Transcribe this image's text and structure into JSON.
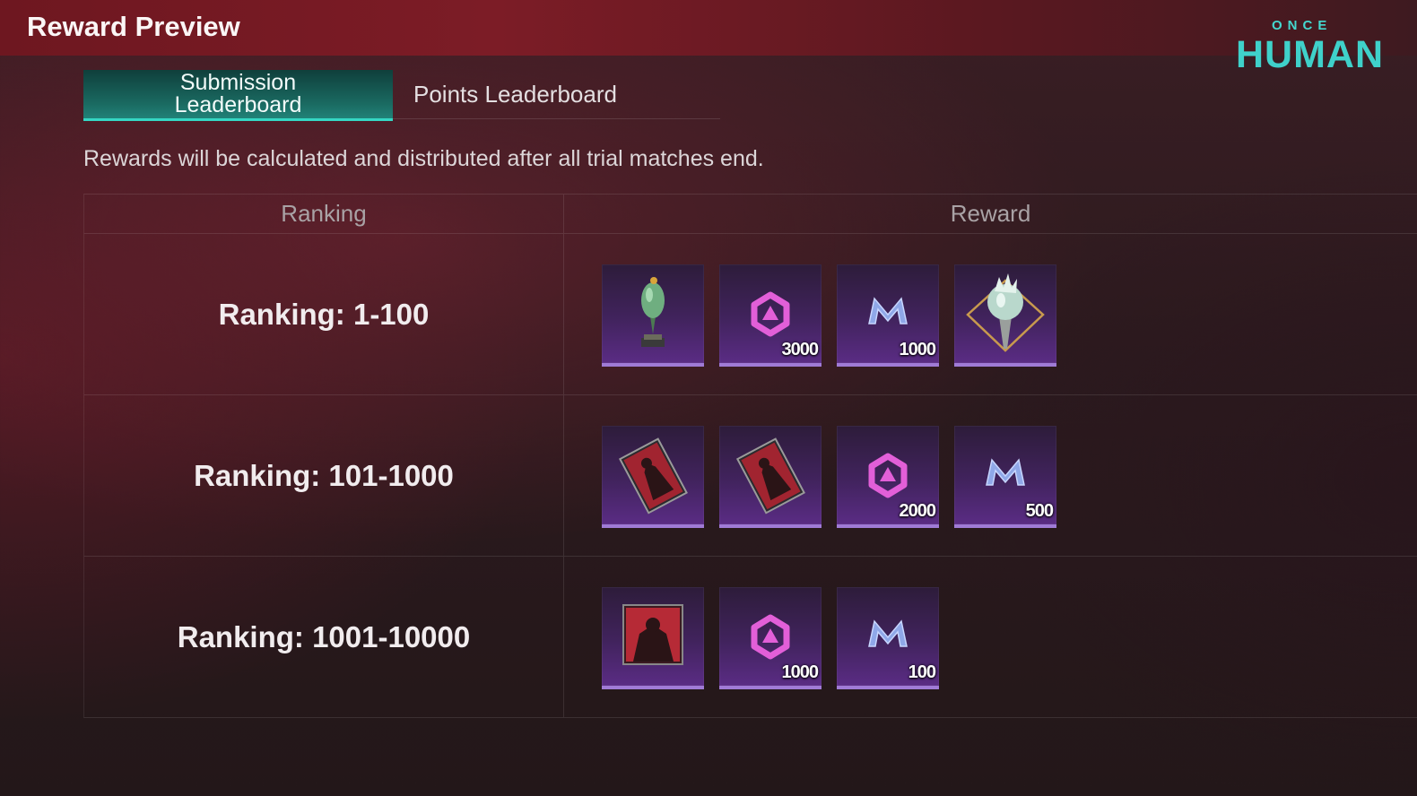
{
  "window": {
    "title": "Reward Preview"
  },
  "brand": {
    "top": "ONCE",
    "bottom": "HUMAN",
    "accent_color": "#3fd1ca"
  },
  "tabs": [
    {
      "label": "Submission Leaderboard",
      "active": true
    },
    {
      "label": "Points Leaderboard",
      "active": false
    }
  ],
  "notice": "Rewards will be calculated and distributed after all trial matches end.",
  "table": {
    "headers": {
      "ranking": "Ranking",
      "reward": "Reward"
    },
    "rows": [
      {
        "ranking": "Ranking: 1-100",
        "rewards": [
          {
            "icon": "green-trophy-decoration-icon",
            "qty": ""
          },
          {
            "icon": "hexagon-currency-icon",
            "qty": "3000"
          },
          {
            "icon": "m-currency-icon",
            "qty": "1000"
          },
          {
            "icon": "torch-badge-icon",
            "qty": ""
          }
        ]
      },
      {
        "ranking": "Ranking: 101-1000",
        "rewards": [
          {
            "icon": "red-card-icon",
            "qty": ""
          },
          {
            "icon": "red-card-icon",
            "qty": ""
          },
          {
            "icon": "hexagon-currency-icon",
            "qty": "2000"
          },
          {
            "icon": "m-currency-icon",
            "qty": "500"
          }
        ]
      },
      {
        "ranking": "Ranking: 1001-10000",
        "rewards": [
          {
            "icon": "portrait-frame-icon",
            "qty": ""
          },
          {
            "icon": "hexagon-currency-icon",
            "qty": "1000"
          },
          {
            "icon": "m-currency-icon",
            "qty": "100"
          }
        ]
      }
    ]
  },
  "colors": {
    "tab_active": "#218278",
    "tab_underline": "#35d7c4",
    "item_bg": "#41235d",
    "item_border": "#a07bd6",
    "header_red": "#7c1c26"
  }
}
